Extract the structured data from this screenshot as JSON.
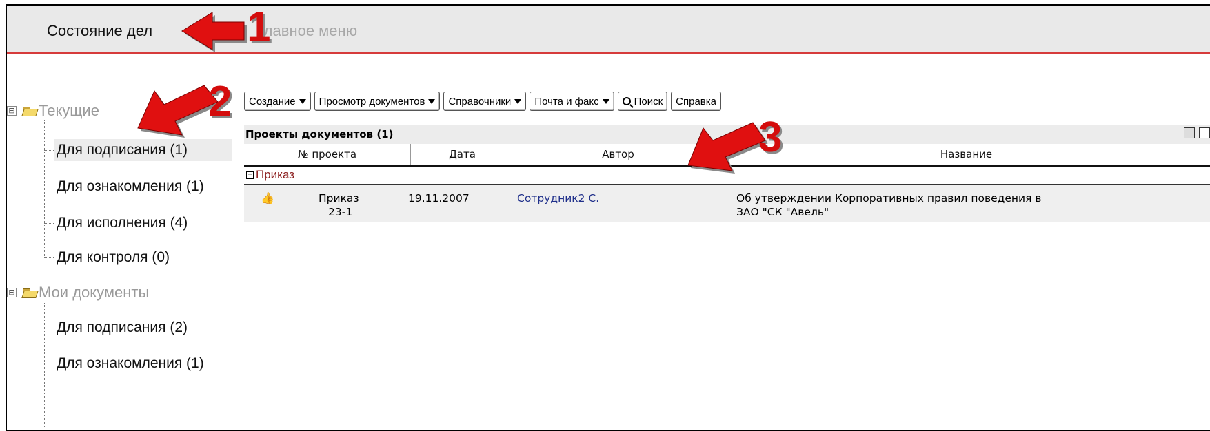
{
  "header": {
    "title": "Состояние дел",
    "menu_label": "Главное меню"
  },
  "sidebar": {
    "groups": [
      {
        "label": "Текущие",
        "toggle": "⊟",
        "items": [
          {
            "label": "Для подписания (1)"
          },
          {
            "label": "Для ознакомления (1)"
          },
          {
            "label": "Для исполнения (4)"
          },
          {
            "label": "Для контроля (0)"
          }
        ]
      },
      {
        "label": "Мои документы",
        "toggle": "⊟",
        "items": [
          {
            "label": "Для подписания (2)"
          },
          {
            "label": "Для ознакомления (1)"
          }
        ]
      }
    ]
  },
  "toolbar": {
    "create": "Создание",
    "view_docs": "Просмотр документов",
    "references": "Справочники",
    "mail_fax": "Почта и факс",
    "search": "Поиск",
    "help": "Справка"
  },
  "grid": {
    "title": "Проекты документов (1)",
    "columns": {
      "number": "№ проекта",
      "date": "Дата",
      "author": "Автор",
      "name": "Название"
    },
    "group": {
      "label": "Приказ",
      "toggle": "−"
    },
    "rows": [
      {
        "icon": "thumbs-up-icon",
        "number_line1": "Приказ",
        "number_line2": "23-1",
        "date": "19.11.2007",
        "author": "Сотрудник2 С.",
        "name_line1": "Об утверждении Корпоративных правил поведения в",
        "name_line2": "ЗАО \"СК \"Авель\""
      }
    ]
  },
  "annotations": {
    "one": "1",
    "two": "2",
    "three": "3",
    "color": "#d40c0c"
  }
}
